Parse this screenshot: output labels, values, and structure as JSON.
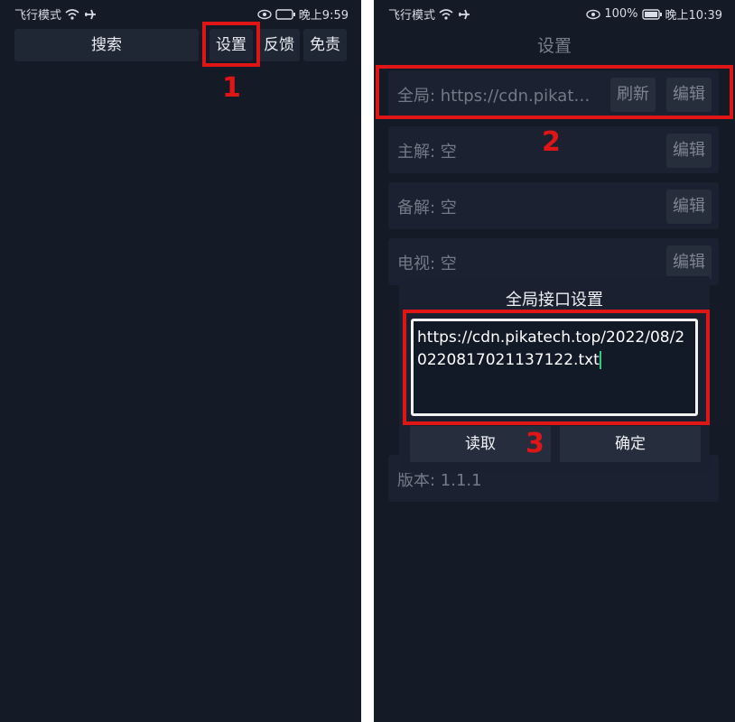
{
  "left_screen": {
    "status": {
      "carrier": "飞行模式",
      "time": "晚上9:59"
    },
    "search_label": "搜索",
    "settings_label": "设置",
    "feedback_label": "反馈",
    "disclaimer_label": "免责",
    "marker": "1"
  },
  "right_screen": {
    "status": {
      "carrier": "飞行模式",
      "battery": "100%",
      "time": "晚上10:39"
    },
    "title": "设置",
    "rows": [
      {
        "label": "全局:  https://cdn.pikat…",
        "refresh": "刷新",
        "edit": "编辑"
      },
      {
        "label": "主解:  空",
        "edit": "编辑"
      },
      {
        "label": "备解:  空",
        "edit": "编辑"
      },
      {
        "label": "电视:  空",
        "edit": "编辑"
      }
    ],
    "version": "版本:  1.1.1",
    "dialog": {
      "title": "全局接口设置",
      "url": "https://cdn.pikatech.top/2022/08/20220817021137122.txt",
      "read_label": "读取",
      "confirm_label": "确定"
    },
    "marker2": "2",
    "marker3": "3"
  }
}
